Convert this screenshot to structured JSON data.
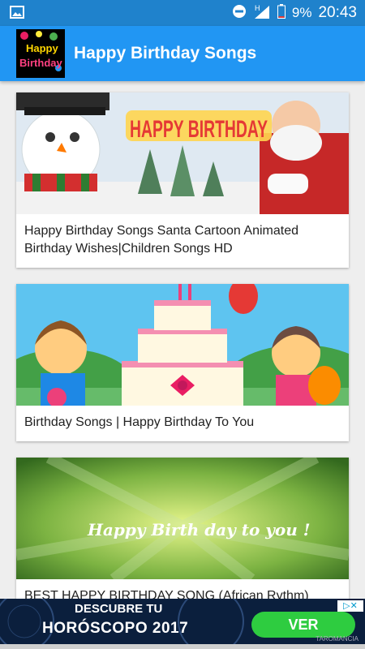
{
  "status_bar": {
    "network": "H",
    "battery_percent": "9%",
    "time": "20:43"
  },
  "app_bar": {
    "title": "Happy Birthday Songs",
    "logo_text_line1": "Happy",
    "logo_text_line2": "Birthday"
  },
  "videos": [
    {
      "title": "Happy Birthday Songs Santa Cartoon Animated Birthday Wishes|Children Songs HD",
      "thumbnail_text": "HAPPY BIRTHDAY"
    },
    {
      "title": "Birthday Songs | Happy Birthday To You",
      "thumbnail_text": ""
    },
    {
      "title": "BEST HAPPY BIRTHDAY SONG (African Rythm)",
      "thumbnail_text": "Happy Birth day to you !"
    }
  ],
  "ad": {
    "line1": "DESCUBRE TU",
    "line2": "HORÓSCOPO 2017",
    "cta": "VER",
    "brand": "TAROMANCIA",
    "choices_icon": "adchoices-icon"
  },
  "colors": {
    "status_bar": "#1f82cc",
    "app_bar": "#2196f3",
    "ad_cta": "#2ecc40"
  }
}
